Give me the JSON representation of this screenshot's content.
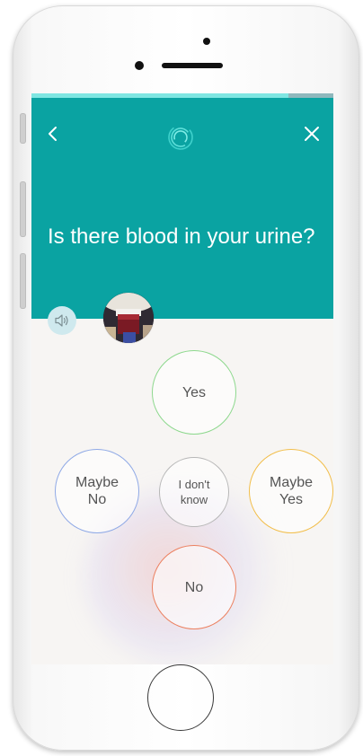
{
  "progress": {
    "fraction": 0.85,
    "fill_color": "#7fe6e2",
    "track_color": "#8fb8bd"
  },
  "header": {
    "background_color": "#0aa3a2",
    "back_icon": "chevron-left-icon",
    "logo_icon": "spiral-logo-icon",
    "close_icon": "close-icon"
  },
  "question": {
    "text": "Is there blood in your urine?"
  },
  "audio": {
    "icon": "speaker-icon"
  },
  "answers": {
    "yes": {
      "label": "Yes",
      "color": "#8dd88d"
    },
    "maybe_no": {
      "label_line1": "Maybe",
      "label_line2": "No",
      "color": "#8fa9e6"
    },
    "dont_know": {
      "label_line1": "I don't",
      "label_line2": "know",
      "color": "#b7b7b7"
    },
    "maybe_yes": {
      "label_line1": "Maybe",
      "label_line2": "Yes",
      "color": "#f2be4a"
    },
    "no": {
      "label": "No",
      "color": "#ec8060"
    }
  }
}
